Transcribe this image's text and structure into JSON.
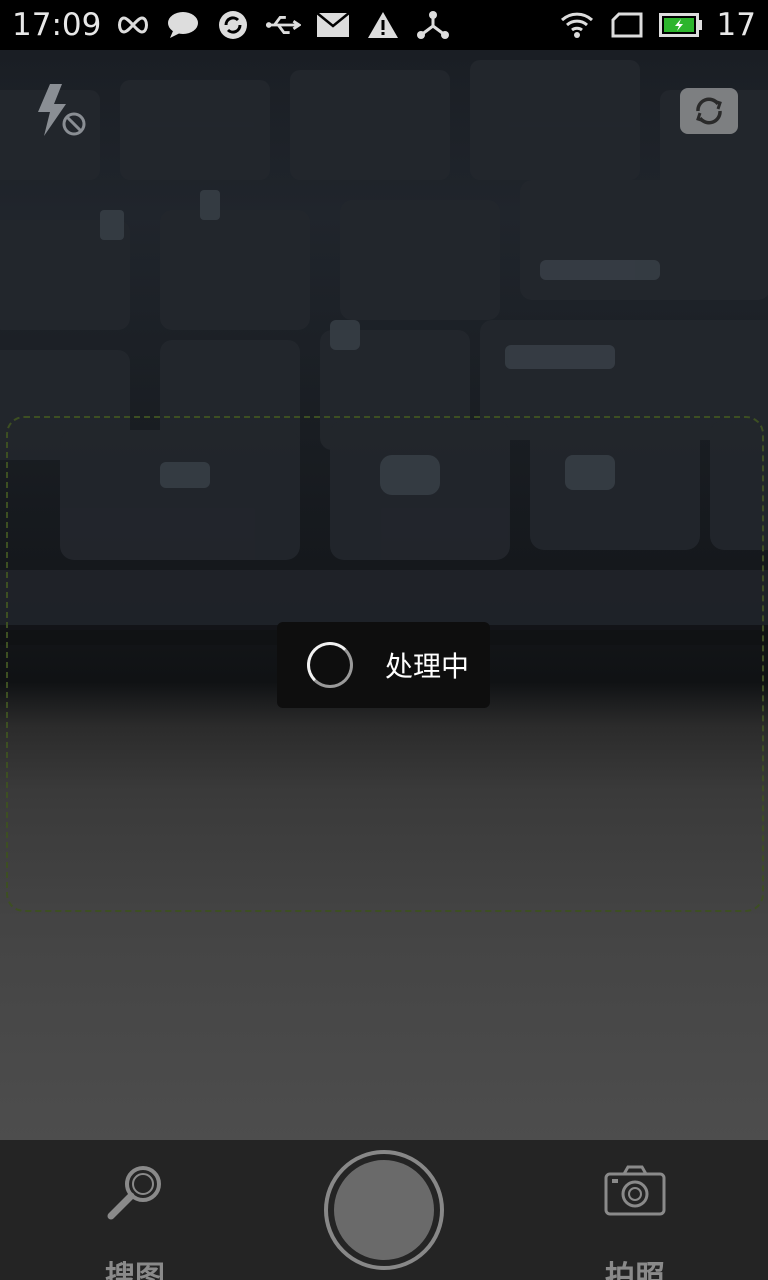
{
  "status_bar": {
    "time": "17:09",
    "battery_level": "17",
    "left_icons": [
      "infinity-icon",
      "chat-icon",
      "sync-icon",
      "usb-icon",
      "mail-icon",
      "warning-icon",
      "share-icon"
    ],
    "right_icons": [
      "wifi-icon",
      "sim-icon",
      "battery-icon"
    ]
  },
  "camera": {
    "flash": "flash-off-icon",
    "switch_camera": "switch-camera-icon",
    "processing_text": "处理中"
  },
  "bottom_bar": {
    "search_label": "搜图",
    "photo_label": "拍照"
  },
  "colors": {
    "scan_frame": "#3d4f22",
    "bottom_bar": "#242424",
    "battery_fill": "#2cb52c"
  }
}
